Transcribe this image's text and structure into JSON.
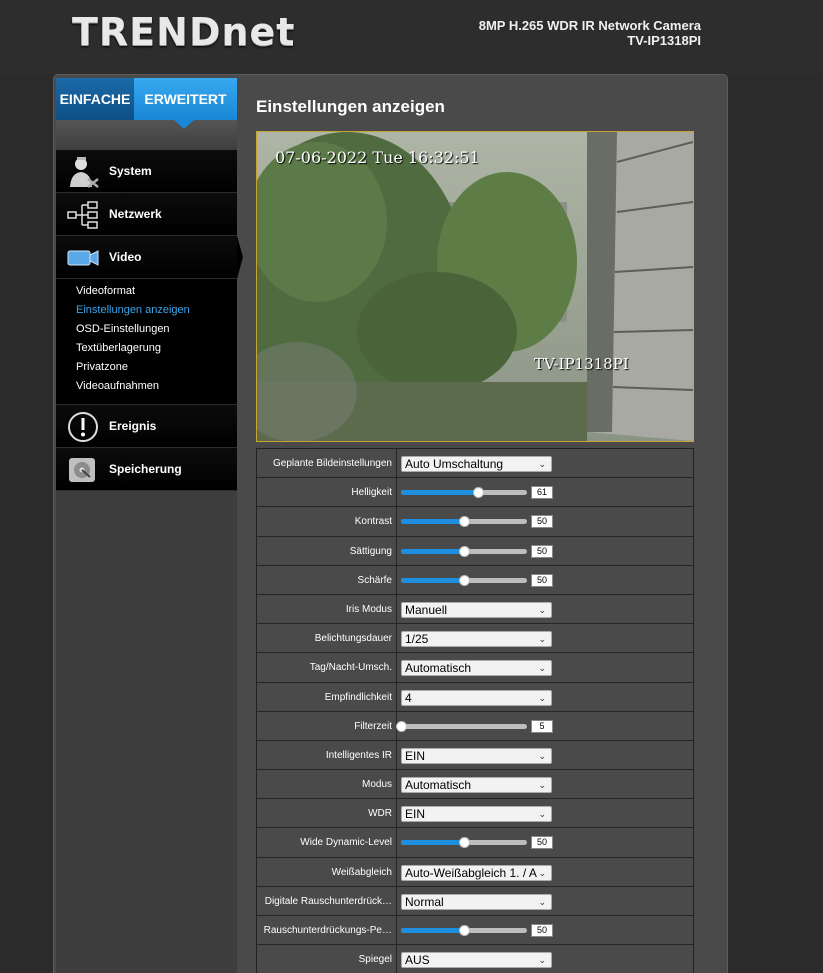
{
  "header": {
    "logo": "TRENDnet",
    "model_line1": "8MP H.265 WDR IR Network Camera",
    "model_line2": "TV-IP1318PI"
  },
  "tabs": {
    "simple": "EINFACHE",
    "advanced": "ERWEITERT"
  },
  "nav": {
    "system": "System",
    "network": "Netzwerk",
    "video": "Video",
    "event": "Ereignis",
    "storage": "Speicherung",
    "video_sub": [
      "Videoformat",
      "Einstellungen anzeigen",
      "OSD-Einstellungen",
      "Textüberlagerung",
      "Privatzone",
      "Videoaufnahmen"
    ]
  },
  "page_title": "Einstellungen anzeigen",
  "preview": {
    "timestamp": "07-06-2022 Tue 16:32:51",
    "camera_name": "TV-IP1318PI"
  },
  "settings": [
    {
      "label": "Geplante Bildeinstellungen",
      "type": "select",
      "value": "Auto Umschaltung"
    },
    {
      "label": "Helligkeit",
      "type": "slider",
      "value": "61",
      "level": 0.61
    },
    {
      "label": "Kontrast",
      "type": "slider",
      "value": "50",
      "level": 0.5
    },
    {
      "label": "Sättigung",
      "type": "slider",
      "value": "50",
      "level": 0.5
    },
    {
      "label": "Schärfe",
      "type": "slider",
      "value": "50",
      "level": 0.5
    },
    {
      "label": "Iris Modus",
      "type": "select",
      "value": "Manuell"
    },
    {
      "label": "Belichtungsdauer",
      "type": "select",
      "value": "1/25"
    },
    {
      "label": "Tag/Nacht-Umsch.",
      "type": "select",
      "value": "Automatisch"
    },
    {
      "label": "Empfindlichkeit",
      "type": "select",
      "value": "4"
    },
    {
      "label": "Filterzeit",
      "type": "slider",
      "value": "5",
      "level": 0.0
    },
    {
      "label": "Intelligentes IR",
      "type": "select",
      "value": "EIN"
    },
    {
      "label": "Modus",
      "type": "select",
      "value": "Automatisch"
    },
    {
      "label": "WDR",
      "type": "select",
      "value": "EIN"
    },
    {
      "label": "Wide Dynamic-Level",
      "type": "slider",
      "value": "50",
      "level": 0.5
    },
    {
      "label": "Weißabgleich",
      "type": "select",
      "value": "Auto-Weißabgleich 1. / A"
    },
    {
      "label": "Digitale Rauschunterdrück…",
      "type": "select",
      "value": "Normal"
    },
    {
      "label": "Rauschunterdrückungs-Pe…",
      "type": "slider",
      "value": "50",
      "level": 0.5
    },
    {
      "label": "Spiegel",
      "type": "select",
      "value": "AUS"
    }
  ],
  "colors": {
    "accent": "#1e8ee0",
    "active_link": "#3aa6ea",
    "preview_border": "#c8a532"
  }
}
